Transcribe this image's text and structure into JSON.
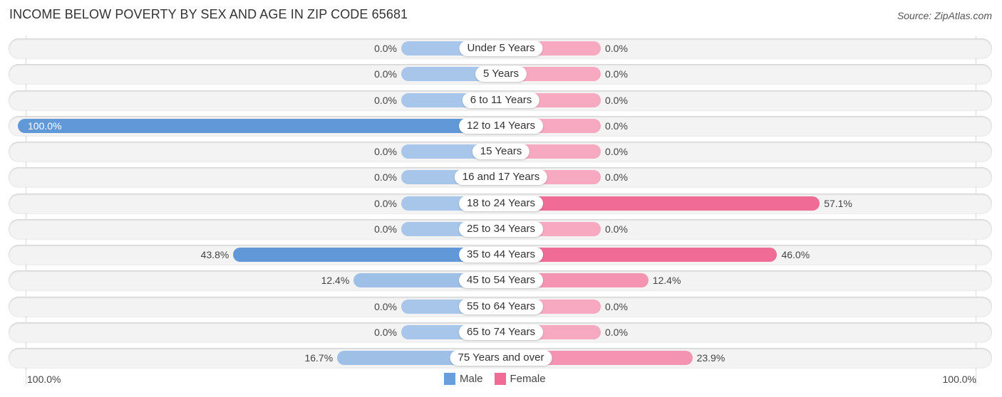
{
  "title": "INCOME BELOW POVERTY BY SEX AND AGE IN ZIP CODE 65681",
  "source": "Source: ZipAtlas.com",
  "colors": {
    "male_strong": "#6199d8",
    "male_light": "#a8c6e9",
    "female_strong": "#f06b95",
    "female_light": "#f6a9c1"
  },
  "axis": {
    "left_label": "100.0%",
    "right_label": "100.0%"
  },
  "legend": [
    {
      "label": "Male",
      "color": "#6a9fdc"
    },
    {
      "label": "Female",
      "color": "#f06b95"
    }
  ],
  "chart_data": {
    "type": "bar",
    "title": "INCOME BELOW POVERTY BY SEX AND AGE IN ZIP CODE 65681",
    "orientation": "horizontal-diverging",
    "xlim": [
      0,
      100
    ],
    "categories": [
      "Under 5 Years",
      "5 Years",
      "6 to 11 Years",
      "12 to 14 Years",
      "15 Years",
      "16 and 17 Years",
      "18 to 24 Years",
      "25 to 34 Years",
      "35 to 44 Years",
      "45 to 54 Years",
      "55 to 64 Years",
      "65 to 74 Years",
      "75 Years and over"
    ],
    "series": [
      {
        "name": "Male",
        "values": [
          0.0,
          0.0,
          0.0,
          100.0,
          0.0,
          0.0,
          0.0,
          0.0,
          43.8,
          12.4,
          0.0,
          0.0,
          16.7
        ],
        "labels": [
          "0.0%",
          "0.0%",
          "0.0%",
          "100.0%",
          "0.0%",
          "0.0%",
          "0.0%",
          "0.0%",
          "43.8%",
          "12.4%",
          "0.0%",
          "0.0%",
          "16.7%"
        ]
      },
      {
        "name": "Female",
        "values": [
          0.0,
          0.0,
          0.0,
          0.0,
          0.0,
          0.0,
          57.1,
          0.0,
          46.0,
          12.4,
          0.0,
          0.0,
          23.9
        ],
        "labels": [
          "0.0%",
          "0.0%",
          "0.0%",
          "0.0%",
          "0.0%",
          "0.0%",
          "57.1%",
          "0.0%",
          "46.0%",
          "12.4%",
          "0.0%",
          "0.0%",
          "23.9%"
        ]
      }
    ],
    "legend_position": "bottom-center"
  }
}
